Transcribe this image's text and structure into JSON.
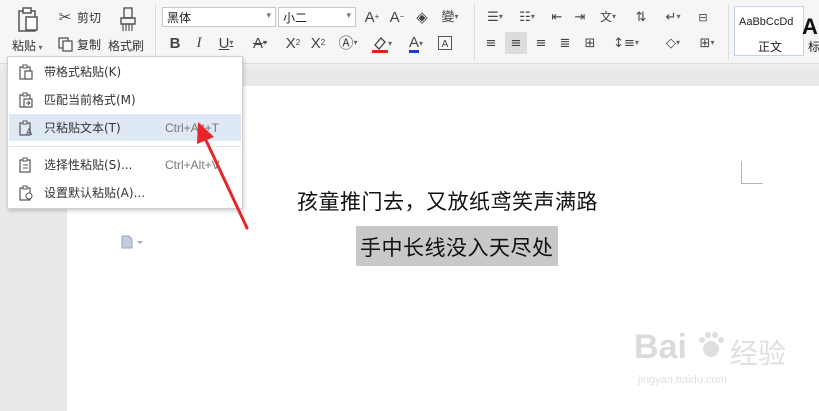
{
  "ribbon": {
    "paste_label": "粘贴",
    "cut_label": "剪切",
    "copy_label": "复制",
    "format_painter_label": "格式刷",
    "font_name": "黑体",
    "font_size": "小二",
    "style_sample": "AaBbCcDd",
    "style_name": "正文",
    "style_next_sample": "A",
    "style_next_name": "标"
  },
  "paste_menu": {
    "items": [
      {
        "label": "带格式粘贴(K)",
        "shortcut": "",
        "icon": "paste-with-format-icon"
      },
      {
        "label": "匹配当前格式(M)",
        "shortcut": "",
        "icon": "match-format-icon"
      },
      {
        "label": "只粘贴文本(T)",
        "shortcut": "Ctrl+Alt+T",
        "icon": "paste-text-only-icon",
        "highlighted": true
      },
      {
        "label": "选择性粘贴(S)...",
        "shortcut": "Ctrl+Alt+V",
        "icon": "paste-special-icon"
      },
      {
        "label": "设置默认粘贴(A)...",
        "shortcut": "",
        "icon": "default-paste-settings-icon"
      }
    ]
  },
  "document": {
    "line1": "孩童推门去，又放纸鸢笑声满路",
    "line2": "手中长线没入天尽处"
  },
  "watermark": {
    "brand": "Bai",
    "brand_cn": "经验",
    "url": "jingyan.baidu.com"
  },
  "colors": {
    "arrow": "#e8262a",
    "menu_highlight": "#dfe8f5",
    "selection": "#c8c8c8",
    "font_color_bar": "#1a3ccf",
    "highlight_color_bar": "#e2231a"
  }
}
